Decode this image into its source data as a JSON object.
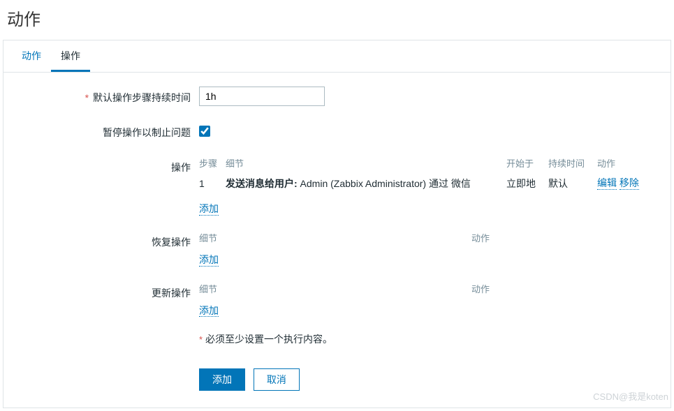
{
  "page_title": "动作",
  "tabs": [
    {
      "label": "动作",
      "active": false
    },
    {
      "label": "操作",
      "active": true
    }
  ],
  "form": {
    "default_duration": {
      "label": "默认操作步骤持续时间",
      "required": true,
      "value": "1h"
    },
    "pause_suppressed": {
      "label": "暂停操作以制止问题",
      "checked": true
    },
    "operations": {
      "label": "操作",
      "headers": {
        "step": "步骤",
        "detail": "细节",
        "start": "开始于",
        "duration": "持续时间",
        "action": "动作"
      },
      "rows": [
        {
          "step": "1",
          "detail_prefix": "发送消息给用户:",
          "detail_rest": " Admin (Zabbix Administrator) 通过 微信",
          "start": "立即地",
          "duration": "默认",
          "edit": "编辑",
          "remove": "移除"
        }
      ],
      "add_label": "添加"
    },
    "recovery_operations": {
      "label": "恢复操作",
      "headers": {
        "detail": "细节",
        "action": "动作"
      },
      "add_label": "添加"
    },
    "update_operations": {
      "label": "更新操作",
      "headers": {
        "detail": "细节",
        "action": "动作"
      },
      "add_label": "添加"
    },
    "hint": {
      "star": "*",
      "text": "必须至少设置一个执行内容。"
    },
    "buttons": {
      "submit": "添加",
      "cancel": "取消"
    }
  },
  "watermark": "CSDN@我是koten"
}
